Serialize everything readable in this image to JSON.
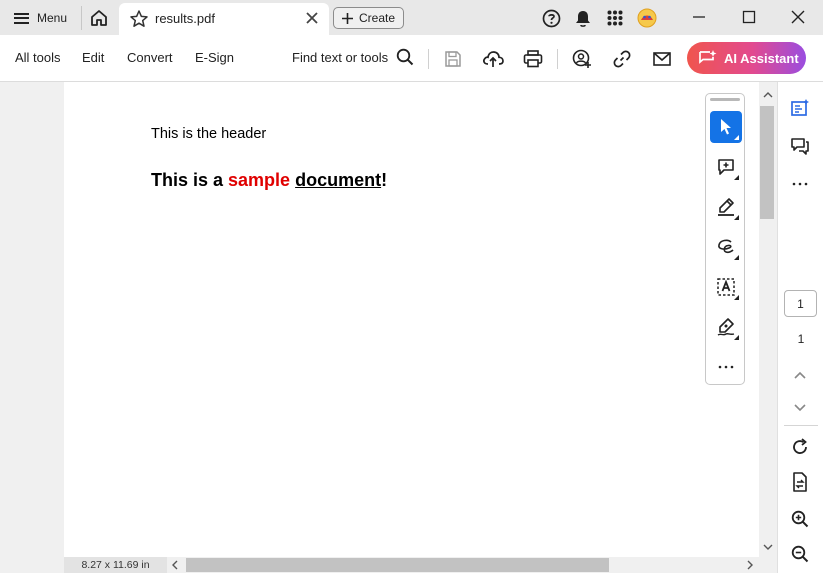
{
  "tabbar": {
    "menu_label": "Menu",
    "tab_title": "results.pdf",
    "create_label": "Create"
  },
  "toolbar": {
    "items": [
      "All tools",
      "Edit",
      "Convert",
      "E-Sign"
    ],
    "find_label": "Find text or tools",
    "ai_label": "AI Assistant"
  },
  "document": {
    "header_text": "This is the header",
    "title_part1": "This is a ",
    "title_red": "sample",
    "title_space": " ",
    "title_underlined": "document",
    "title_end": "!"
  },
  "status": {
    "page_size": "8.27 x 11.69 in"
  },
  "rail": {
    "current_page": "1",
    "total_pages": "1"
  },
  "colors": {
    "accent": "#1473e6",
    "red_text": "#e00000",
    "ai_gradient_start": "#f0554d",
    "ai_gradient_end": "#9a4de0"
  },
  "icons": [
    "hamburger-icon",
    "home-icon",
    "star-icon",
    "close-icon",
    "plus-icon",
    "help-icon",
    "bell-icon",
    "apps-grid-icon",
    "profile-icon",
    "minimize-icon",
    "maximize-icon",
    "window-close-icon",
    "search-icon",
    "save-icon",
    "upload-icon",
    "print-icon",
    "share-user-icon",
    "link-icon",
    "mail-icon",
    "ai-icon",
    "select-cursor-icon",
    "comment-add-icon",
    "highlighter-icon",
    "lasso-icon",
    "text-recognize-icon",
    "sign-pen-icon",
    "more-icon",
    "panel-icon",
    "comments-icon",
    "refresh-icon",
    "file-convert-icon",
    "zoom-in-icon",
    "zoom-out-icon",
    "chevron-up-icon",
    "chevron-down-icon",
    "chevron-left-icon",
    "chevron-right-icon"
  ]
}
